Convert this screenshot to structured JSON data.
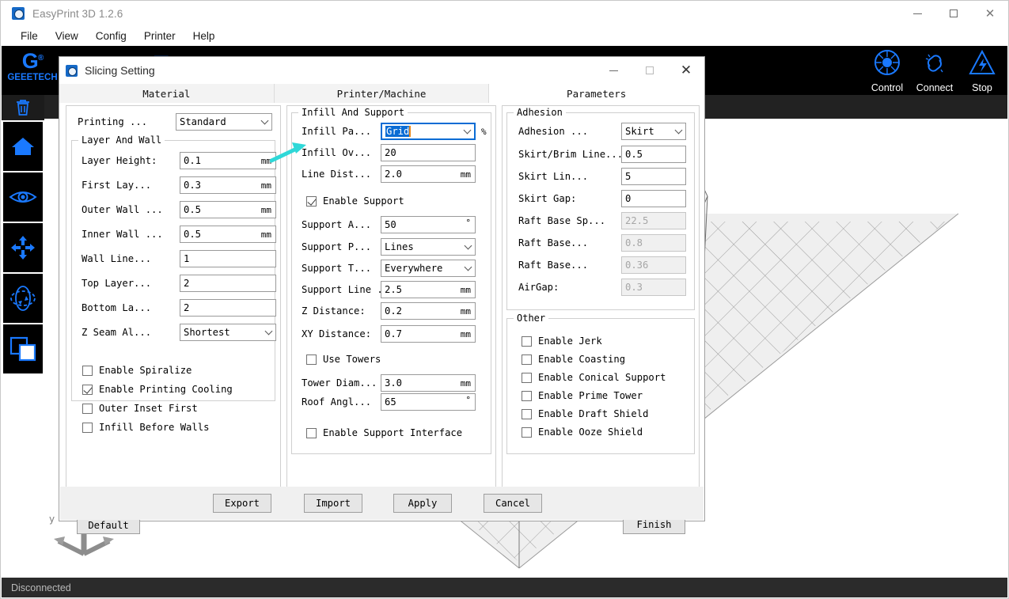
{
  "app": {
    "title": "EasyPrint 3D 1.2.6",
    "menu": [
      "File",
      "View",
      "Config",
      "Printer",
      "Help"
    ],
    "brand_mark": "G",
    "brand_sup": "®",
    "brand_name": "GEEETECH",
    "window_controls": {
      "minimize": "—",
      "maximize": "□",
      "close": "✕"
    },
    "status": "Disconnected",
    "right_tools": [
      {
        "label": "Control",
        "icon": "control-dial-icon"
      },
      {
        "label": "Connect",
        "icon": "link-chain-icon"
      },
      {
        "label": "Stop",
        "icon": "stop-warning-icon"
      }
    ],
    "rail": [
      {
        "name": "delete-icon"
      },
      {
        "name": "home-view-icon"
      },
      {
        "name": "eye-view-icon"
      },
      {
        "name": "move-icon"
      },
      {
        "name": "rotate-icon"
      },
      {
        "name": "duplicate-icon"
      }
    ]
  },
  "dialog": {
    "title": "Slicing Setting",
    "window_controls": {
      "minimize": "—",
      "maximize": "□",
      "close": "✕"
    },
    "tabs": [
      {
        "label": "Material",
        "active": false
      },
      {
        "label": "Printer/Machine",
        "active": false
      },
      {
        "label": "Parameters",
        "active": true
      }
    ],
    "left": {
      "printing_label": "Printing ...",
      "printing_value": "Standard",
      "group_title": "Layer And Wall",
      "fields": [
        {
          "label": "Layer Height:",
          "value": "0.1",
          "unit": "mm",
          "type": "text"
        },
        {
          "label": "First Lay...",
          "value": "0.3",
          "unit": "mm",
          "type": "text"
        },
        {
          "label": "Outer Wall ...",
          "value": "0.5",
          "unit": "mm",
          "type": "text"
        },
        {
          "label": "Inner Wall ...",
          "value": "0.5",
          "unit": "mm",
          "type": "text"
        },
        {
          "label": "Wall Line...",
          "value": "1",
          "unit": "",
          "type": "text"
        },
        {
          "label": "Top Layer...",
          "value": "2",
          "unit": "",
          "type": "text"
        },
        {
          "label": "Bottom La...",
          "value": "2",
          "unit": "",
          "type": "text"
        },
        {
          "label": "Z Seam Al...",
          "value": "Shortest",
          "unit": "",
          "type": "combo"
        }
      ],
      "checks": [
        {
          "label": "Enable Spiralize",
          "checked": false
        },
        {
          "label": "Enable Printing Cooling",
          "checked": true
        },
        {
          "label": "Outer Inset First",
          "checked": false
        },
        {
          "label": "Infill Before Walls",
          "checked": false
        }
      ]
    },
    "middle": {
      "group_title": "Infill And Support",
      "infill_pattern_label": "Infill Pa...",
      "infill_pattern_value": "Grid",
      "percent_sign": "%",
      "fields_top": [
        {
          "label": "Infill Ov...",
          "value": "20",
          "unit": "",
          "type": "text"
        },
        {
          "label": "Line Dist...",
          "value": "2.0",
          "unit": "mm",
          "type": "text"
        }
      ],
      "enable_support": {
        "label": "Enable Support",
        "checked": true
      },
      "fields_support": [
        {
          "label": "Support A...",
          "value": "50",
          "unit": "°",
          "type": "text"
        },
        {
          "label": "Support P...",
          "value": "Lines",
          "unit": "",
          "type": "combo"
        },
        {
          "label": "Support T...",
          "value": "Everywhere",
          "unit": "",
          "type": "combo"
        },
        {
          "label": "Support Line ...",
          "value": "2.5",
          "unit": "mm",
          "type": "text"
        },
        {
          "label": "Z Distance:",
          "value": "0.2",
          "unit": "mm",
          "type": "text"
        },
        {
          "label": "XY Distance:",
          "value": "0.7",
          "unit": "mm",
          "type": "text"
        }
      ],
      "use_towers": {
        "label": "Use Towers",
        "checked": false
      },
      "fields_tower": [
        {
          "label": "Tower Diam...",
          "value": "3.0",
          "unit": "mm",
          "type": "text"
        },
        {
          "label": "Roof Angl...",
          "value": "65",
          "unit": "°",
          "type": "text"
        }
      ],
      "support_interface": {
        "label": "Enable Support Interface",
        "checked": false
      }
    },
    "right": {
      "adhesion_title": "Adhesion",
      "adhesion_fields": [
        {
          "label": "Adhesion ...",
          "value": "Skirt",
          "type": "combo",
          "disabled": false
        },
        {
          "label": "Skirt/Brim Line...",
          "value": "0.5",
          "type": "text",
          "disabled": false
        },
        {
          "label": "Skirt Lin...",
          "value": "5",
          "type": "text",
          "disabled": false
        },
        {
          "label": "Skirt Gap:",
          "value": "0",
          "type": "text",
          "disabled": false
        },
        {
          "label": "Raft Base Sp...",
          "value": "22.5",
          "type": "text",
          "disabled": true
        },
        {
          "label": "Raft Base...",
          "value": "0.8",
          "type": "text",
          "disabled": true
        },
        {
          "label": "Raft Base...",
          "value": "0.36",
          "type": "text",
          "disabled": true
        },
        {
          "label": "AirGap:",
          "value": "0.3",
          "type": "text",
          "disabled": true
        }
      ],
      "other_title": "Other",
      "other_checks": [
        {
          "label": "Enable Jerk",
          "checked": false
        },
        {
          "label": "Enable Coasting",
          "checked": false
        },
        {
          "label": "Enable Conical Support",
          "checked": false
        },
        {
          "label": "Enable Prime Tower",
          "checked": false
        },
        {
          "label": "Enable Draft Shield",
          "checked": false
        },
        {
          "label": "Enable Ooze Shield",
          "checked": false
        }
      ]
    },
    "buttons": {
      "default": "Default",
      "finish": "Finish",
      "export": "Export",
      "import": "Import",
      "apply": "Apply",
      "cancel": "Cancel"
    }
  },
  "colors": {
    "accent_blue": "#1a79ff",
    "toolbar_black": "#000000",
    "selection_blue": "#0a6cd4",
    "cursor_orange": "#e8891c",
    "annotation_cyan": "#2fd8d8",
    "status_bar": "#2b2b2b"
  }
}
